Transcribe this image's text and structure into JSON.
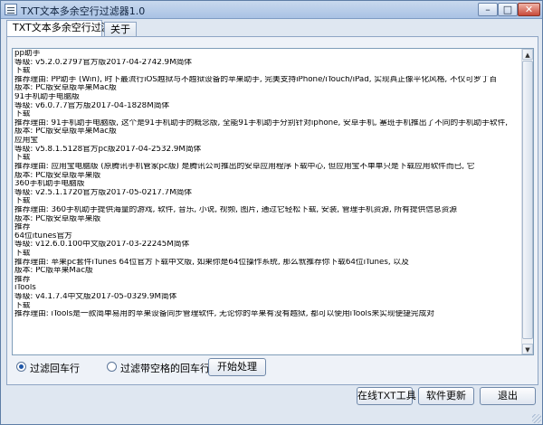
{
  "window": {
    "title": "TXT文本多余空行过滤器1.0",
    "minimize": "–",
    "maximize": "□",
    "close": "✕",
    "icon": "notepad-icon"
  },
  "tabs": [
    {
      "label": "TXT文本多余空行过滤器",
      "active": true
    },
    {
      "label": "关于",
      "active": false
    }
  ],
  "text_content": {
    "lines": [
      "pp助手",
      "等级: v5.2.0.2797官方版2017-04-2742.9M简体",
      "下载",
      "推荐理由: PP助手 (Win), 时下最流行iOS越狱与不越狱设备的苹果助手, 完美支持iPhone/iTouch/iPad, 实现真正像平化风格, 不仅可罗丁百",
      "版本: PC版安卓版苹果Mac版",
      "91手机助手电脑版",
      "等级: v6.0.7.7官方版2017-04-1828M简体",
      "下载",
      "推荐理由: 91手机助手电脑版, 这个是91手机助手的概念版, 全能91手机助手分别针对iphone, 安卓手机, 塞班手机推出了不同的手机助手软件,",
      "版本: PC版安卓版苹果Mac版",
      "应用宝",
      "等级: v5.8.1.5128官方pc版2017-04-2532.9M简体",
      "下载",
      "推荐理由: 应用宝电脑版 (原腾讯手机管家pc版) 是腾讯公司推出的安卓应用程序下载中心, 但应用宝不单单只是下载应用软件而已, 它",
      "版本: PC版安卓版苹果版",
      "360手机助手电脑版",
      "等级: v2.5.1.1720官方版2017-05-0217.7M简体",
      "下载",
      "推荐理由: 360手机助手提供海量的游戏, 软件, 音乐, 小说, 视频, 图片, 通过它轻松下载, 安装, 管理手机资源, 所有提供信息资源",
      "版本: PC版安卓版苹果版",
      "推荐",
      "64位itunes官方",
      "等级: v12.6.0.100中文版2017-03-22245M简体",
      "下载",
      "推荐理由: 苹果pc套件iTunes 64位官方下载中文版, 如果你是64位操作系统, 那么就推荐你下载64位iTunes, 以及",
      "版本: PC版苹果Mac版",
      "推荐",
      "iTools",
      "等级: v4.1.7.4中文版2017-05-0329.9M简体",
      "下载",
      "推荐理由: iTools是一款简单易用的苹果设备同步管理软件, 无论你的苹果有没有越狱, 都可以使用iTools来实现便捷完成对"
    ]
  },
  "options": {
    "opt1": {
      "label": "过滤回车行",
      "checked": true
    },
    "opt2": {
      "label": "过滤带空格的回车行",
      "checked": false
    }
  },
  "buttons": {
    "start": "开始处理",
    "online": "在线TXT工具",
    "update": "软件更新",
    "exit": "退出"
  }
}
